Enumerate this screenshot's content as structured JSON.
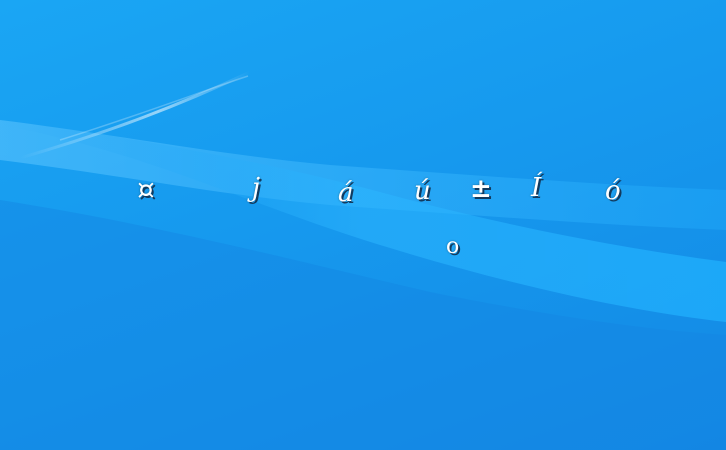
{
  "desktop": {
    "glyphs": [
      "¤",
      "j",
      "á",
      "ú",
      "±",
      "Í",
      "ó",
      "o"
    ],
    "colors": {
      "background_light": "#1aa6f4",
      "background_dark": "#1388e4",
      "glyph": "#ffffff",
      "glyph_shadow": "#123a5e"
    }
  }
}
